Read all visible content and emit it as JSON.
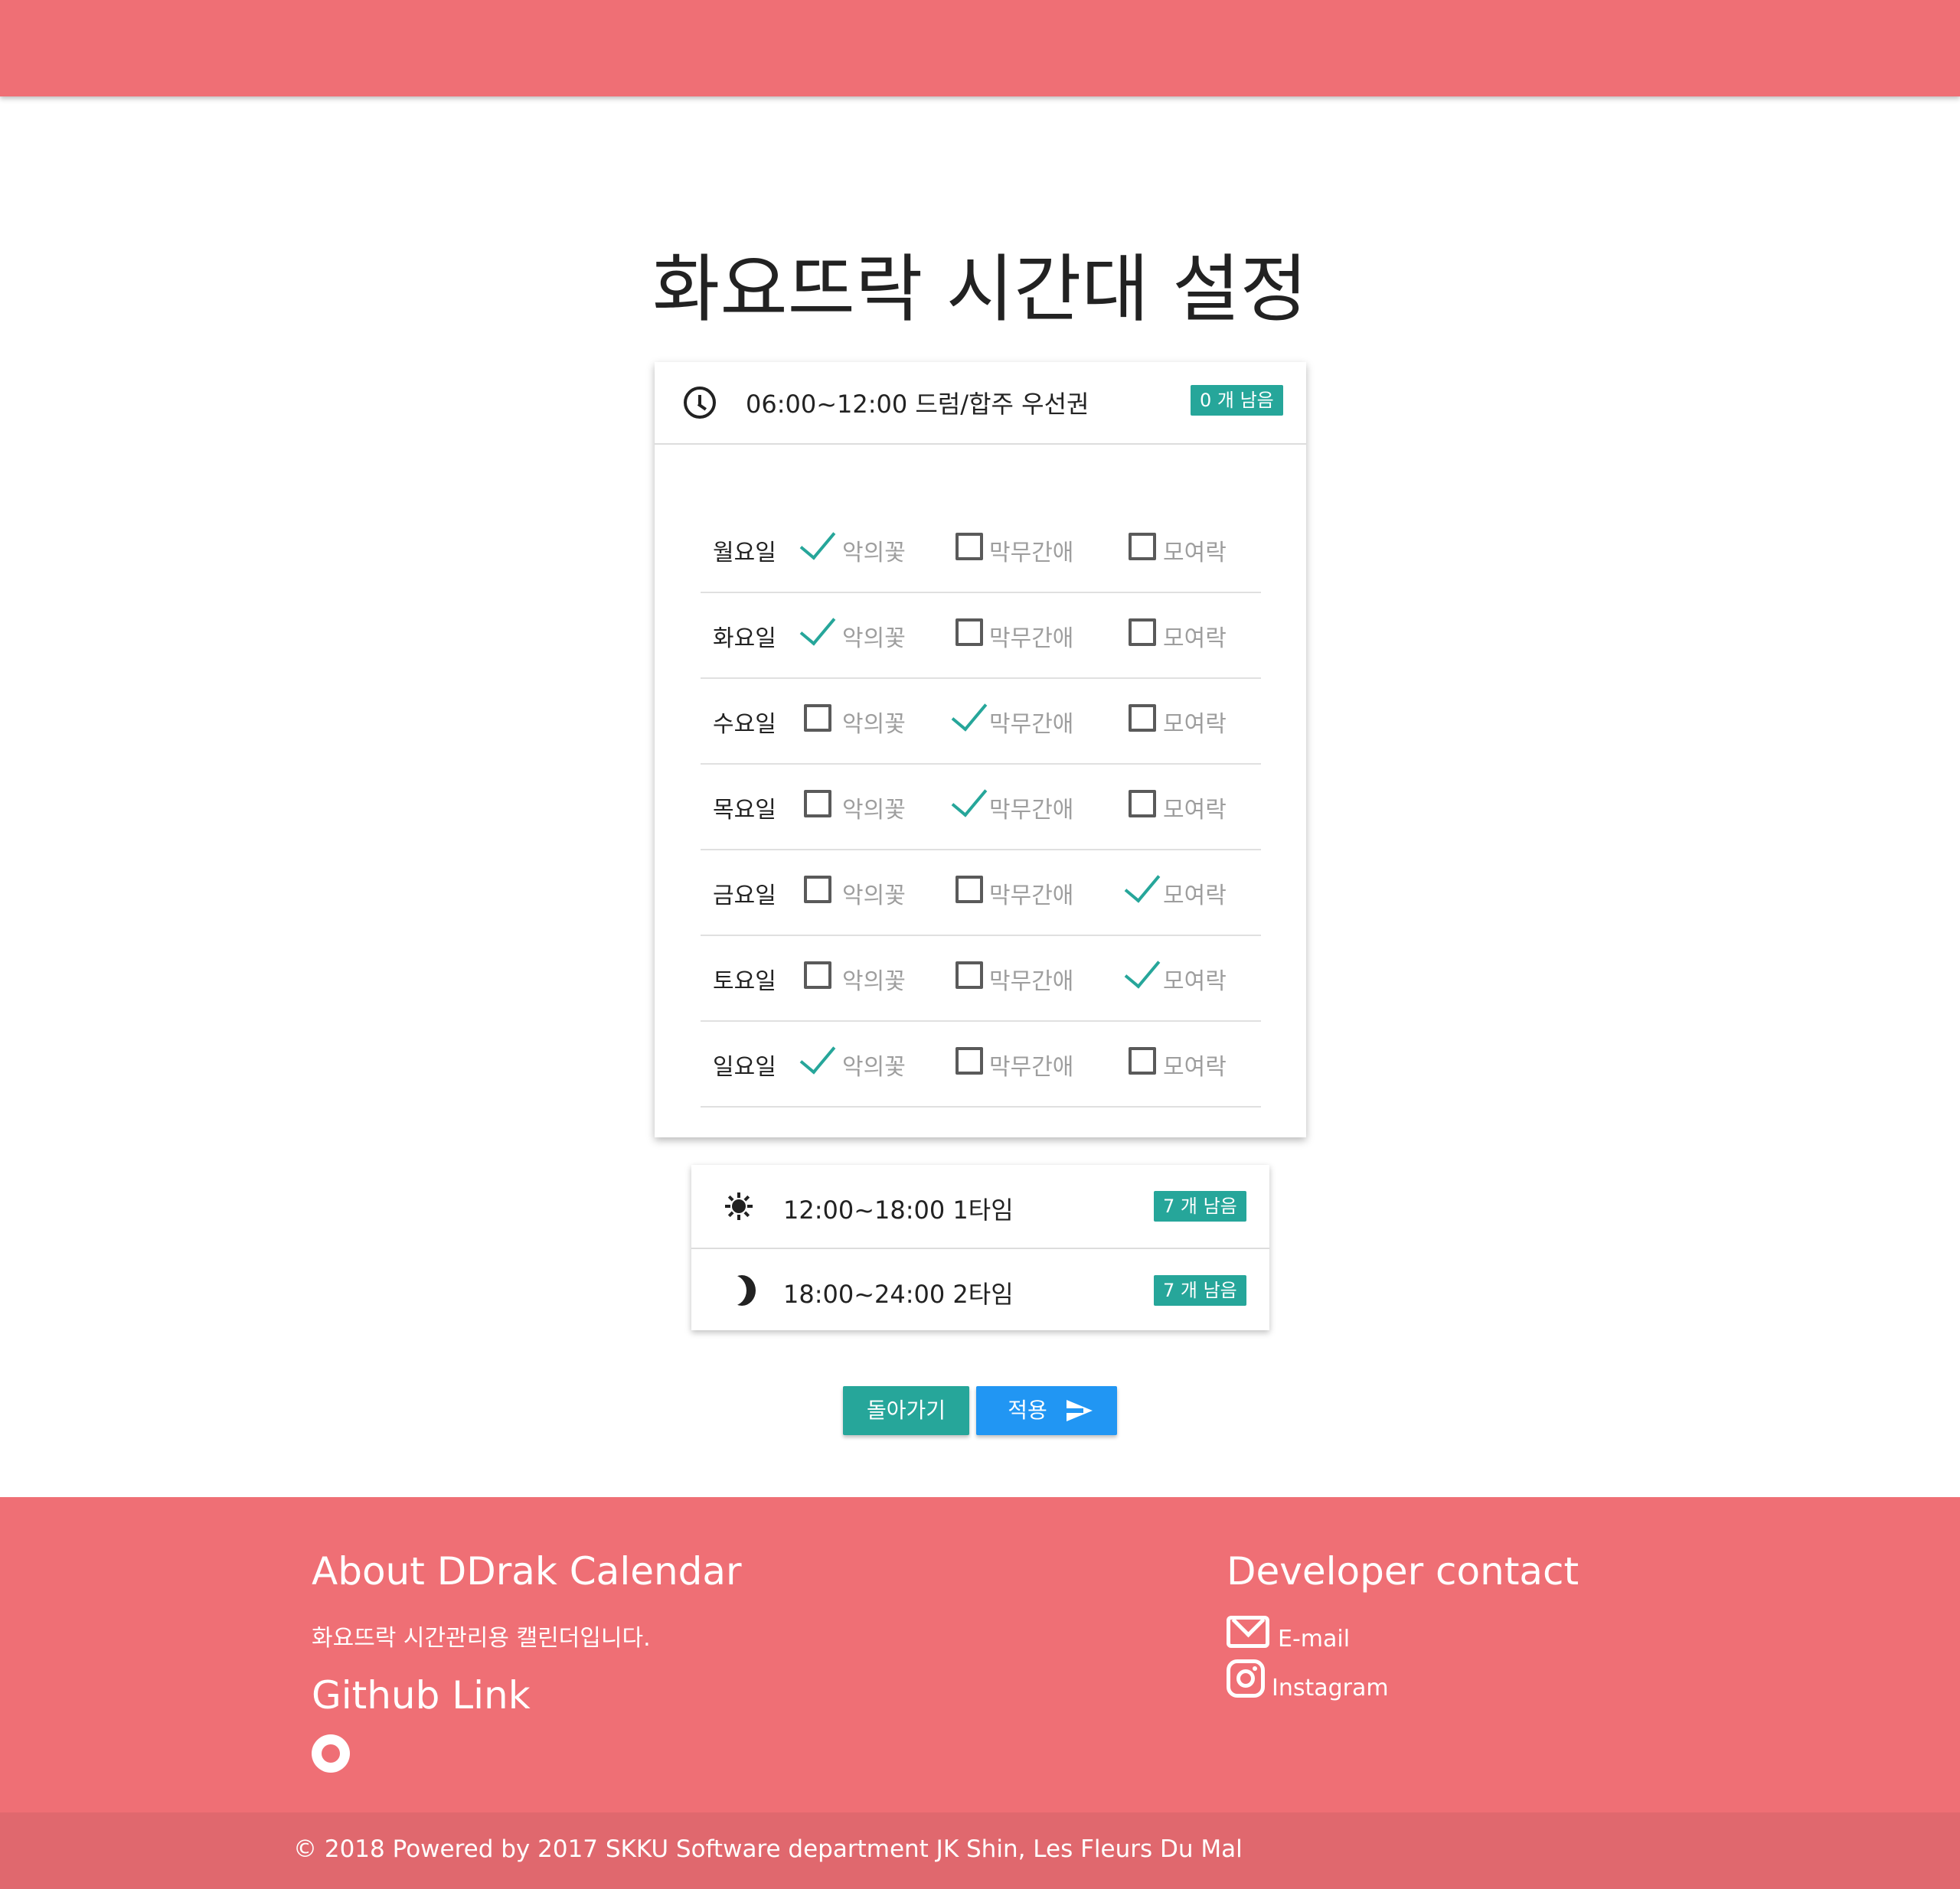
{
  "page": {
    "title": "화요뜨락 시간대 설정"
  },
  "colors": {
    "primary": "#ef6f75",
    "teal": "#26a69a",
    "blue": "#2196f3"
  },
  "morning": {
    "icon": "clock-icon",
    "label": "06:00~12:00 드럼/합주 우선권",
    "badge": "0 개 남음",
    "options": [
      "악의꽃",
      "막무간애",
      "모여락"
    ],
    "days": [
      {
        "day": "월요일",
        "checked": [
          true,
          false,
          false
        ]
      },
      {
        "day": "화요일",
        "checked": [
          true,
          false,
          false
        ]
      },
      {
        "day": "수요일",
        "checked": [
          false,
          true,
          false
        ]
      },
      {
        "day": "목요일",
        "checked": [
          false,
          true,
          false
        ]
      },
      {
        "day": "금요일",
        "checked": [
          false,
          false,
          true
        ]
      },
      {
        "day": "토요일",
        "checked": [
          false,
          false,
          true
        ]
      },
      {
        "day": "일요일",
        "checked": [
          true,
          false,
          false
        ]
      }
    ]
  },
  "afternoon": {
    "icon": "sun-icon",
    "label": "12:00~18:00 1타임",
    "badge": "7 개 남음"
  },
  "evening": {
    "icon": "moon-icon",
    "label": "18:00~24:00 2타임",
    "badge": "7 개 남음"
  },
  "buttons": {
    "back": "돌아가기",
    "apply": "적용"
  },
  "footer": {
    "about_title": "About DDrak Calendar",
    "about_text": "화요뜨락 시간관리용 캘린더입니다.",
    "github_title": "Github Link",
    "contact_title": "Developer contact",
    "email_label": "E-mail",
    "instagram_label": "Instagram",
    "copyright": "© 2018 Powered by 2017 SKKU Software department JK Shin, Les Fleurs Du Mal"
  }
}
